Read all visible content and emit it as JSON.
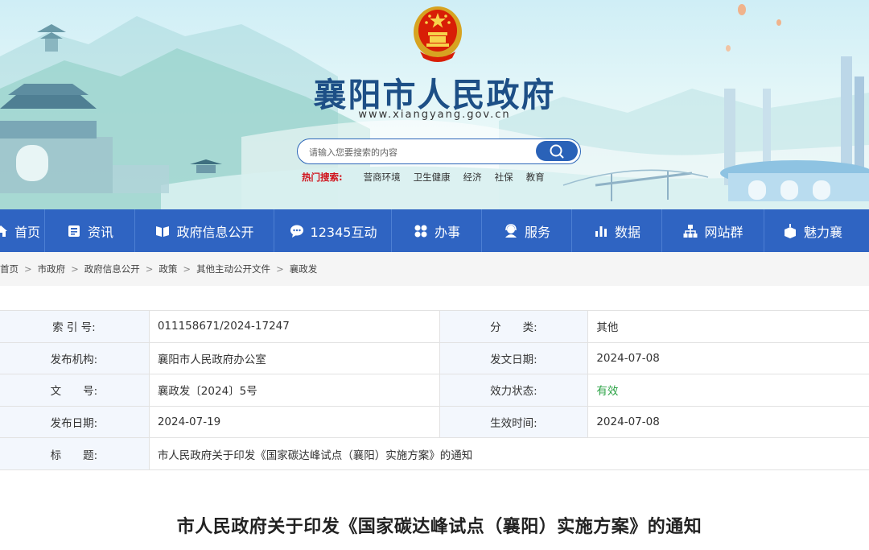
{
  "header": {
    "site_title": "襄阳市人民政府",
    "site_url": "www.xiangyang.gov.cn",
    "search": {
      "placeholder": "请输入您要搜索的内容"
    },
    "hot_search": {
      "label": "热门搜索:",
      "items": [
        "营商环境",
        "卫生健康",
        "经济",
        "社保",
        "教育"
      ]
    }
  },
  "nav": {
    "items": [
      {
        "label": "首页",
        "icon": "home-icon"
      },
      {
        "label": "资讯",
        "icon": "news-icon"
      },
      {
        "label": "政府信息公开",
        "icon": "book-icon"
      },
      {
        "label": "12345互动",
        "icon": "chat-icon"
      },
      {
        "label": "办事",
        "icon": "grid-icon"
      },
      {
        "label": "服务",
        "icon": "service-icon"
      },
      {
        "label": "数据",
        "icon": "bar-chart-icon"
      },
      {
        "label": "网站群",
        "icon": "sitemap-icon"
      },
      {
        "label": "魅力襄",
        "icon": "heart-icon"
      }
    ]
  },
  "breadcrumb": [
    "首页",
    "市政府",
    "政府信息公开",
    "政策",
    "其他主动公开文件",
    "襄政发"
  ],
  "info_table": {
    "rows": [
      {
        "label1": "索 引 号:",
        "value1": "011158671/2024-17247",
        "label2": "分　　类:",
        "value2": "其他"
      },
      {
        "label1": "发布机构:",
        "value1": "襄阳市人民政府办公室",
        "label2": "发文日期:",
        "value2": "2024-07-08"
      },
      {
        "label1": "文　　号:",
        "value1": "襄政发〔2024〕5号",
        "label2": "效力状态:",
        "value2": "有效"
      },
      {
        "label1": "发布日期:",
        "value1": "2024-07-19",
        "label2": "生效时间:",
        "value2": "2024-07-08"
      }
    ],
    "title_row": {
      "label": "标　　题:",
      "value": "市人民政府关于印发《国家碳达峰试点（襄阳）实施方案》的通知"
    }
  },
  "document": {
    "title": "市人民政府关于印发《国家碳达峰试点（襄阳）实施方案》的通知"
  },
  "colors": {
    "nav_bg": "#2f64c2",
    "title_blue": "#1d4f86",
    "hot_red": "#d0121b",
    "valid_green": "#2ba245"
  }
}
